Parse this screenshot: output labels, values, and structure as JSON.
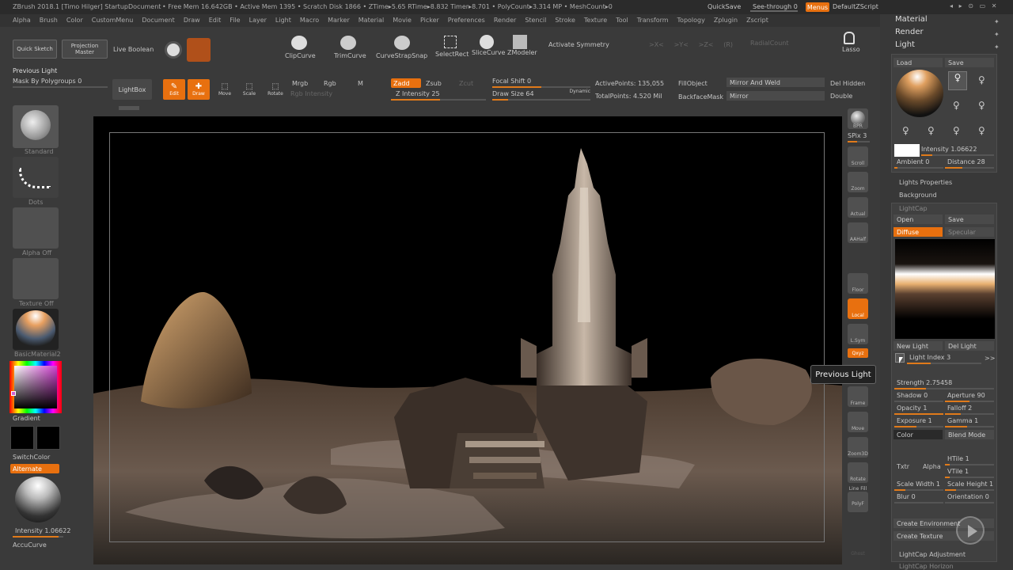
{
  "titlebar": {
    "title": "ZBrush 2018.1 [Timo Hilger]   StartupDocument",
    "stats": "• Free Mem 16.642GB • Active Mem 1395 • Scratch Disk 1866 • ZTime▸5.65 RTime▸8.832 Timer▸8.701 • PolyCount▸3.314 MP • MeshCount▸0",
    "quicksave": "QuickSave",
    "seethrough": "See-through  0",
    "menus": "Menus",
    "defaultzscript": "DefaultZScript"
  },
  "menubar": [
    "Alpha",
    "Brush",
    "Color",
    "CustomMenu",
    "Document",
    "Draw",
    "Edit",
    "File",
    "Layer",
    "Light",
    "Macro",
    "Marker",
    "Material",
    "Movie",
    "Picker",
    "Preferences",
    "Render",
    "Stencil",
    "Stroke",
    "Texture",
    "Tool",
    "Transform",
    "Topology",
    "Zplugin",
    "Zscript"
  ],
  "shelf1": {
    "quicksketch": "Quick Sketch",
    "projectionmaster": "Projection Master",
    "liveboolean": "Live Boolean",
    "clipcurve": "ClipCurve",
    "trimcurve": "TrimCurve",
    "curvestrapsnap": "CurveStrapSnap",
    "selectrect": "SelectRect",
    "slicecurve": "SliceCurve",
    "zmodeler": "ZModeler",
    "activatesymmetry": "Activate Symmetry",
    "lasso": "Lasso",
    "radialcount": "RadialCount"
  },
  "shelf2": {
    "previouslight": "Previous Light",
    "maskbypolygroups": "Mask By Polygroups 0",
    "lightbox": "LightBox",
    "edit": "Edit",
    "draw": "Draw",
    "move": "Move",
    "scale": "Scale",
    "rotate": "Rotate",
    "mrgb": "Mrgb",
    "rgb": "Rgb",
    "m": "M",
    "rgbintensity": "Rgb Intensity",
    "zadd": "Zadd",
    "zsub": "Zsub",
    "zcut": "Zcut",
    "zintensity": "Z Intensity 25",
    "focalshift": "Focal Shift 0",
    "drawsize": "Draw Size 64",
    "dynamic": "Dynamic",
    "activepoints": "ActivePoints: 135,055",
    "totalpoints": "TotalPoints: 4.520 Mil",
    "fillobject": "FillObject",
    "backfacemask": "BackfaceMask",
    "mirrorandweld": "Mirror And Weld",
    "mirror": "Mirror",
    "delhidden": "Del Hidden",
    "double": "Double"
  },
  "leftpanel": {
    "standard": "Standard",
    "dots": "Dots",
    "alphaoff": "Alpha Off",
    "textureoff": "Texture Off",
    "basicmaterial": "BasicMaterial2",
    "gradient": "Gradient",
    "switchcolor": "SwitchColor",
    "alternate": "Alternate",
    "intensity": "Intensity 1.06622",
    "accucurve": "AccuCurve"
  },
  "rightshelf": {
    "bpr": "BPR",
    "spix": "SPix 3",
    "scroll": "Scroll",
    "zoom": "Zoom",
    "actual": "Actual",
    "aahalf": "AAHalf",
    "floor": "Floor",
    "local": "Local",
    "lsym": "L.Sym",
    "xyz": "Qxyz",
    "frame": "Frame",
    "move": "Move",
    "zoom3d": "Zoom3D",
    "rotate": "Rotate",
    "linefill": "Line Fill",
    "polyf": "PolyF",
    "ghost": "Ghost"
  },
  "tooltip": "Previous Light",
  "palette": {
    "material": "Material",
    "render": "Render",
    "light": "Light",
    "load": "Load",
    "save": "Save",
    "intensity": "Intensity 1.06622",
    "ambient": "Ambient 0",
    "distance": "Distance 28",
    "lightsproperties": "Lights Properties",
    "background": "Background",
    "lightcap": "LightCap",
    "open": "Open",
    "save2": "Save",
    "diffuse": "Diffuse",
    "specular": "Specular",
    "newlight": "New Light",
    "dellight": "Del Light",
    "lightindex": "Light Index 3",
    "strength": "Strength 2.75458",
    "shadow": "Shadow 0",
    "aperture": "Aperture 90",
    "opacity": "Opacity 1",
    "falloff": "Falloff 2",
    "exposure": "Exposure 1",
    "gamma": "Gamma 1",
    "color": "Color",
    "blendmode": "Blend Mode",
    "txtr": "Txtr",
    "alpha": "Alpha",
    "htile": "HTile 1",
    "vtile": "VTile 1",
    "scalewidth": "Scale Width 1",
    "scaleheight": "Scale Height 1",
    "blur": "Blur 0",
    "orientation": "Orientation 0",
    "createenvironment": "Create Environment",
    "createtexture": "Create Texture",
    "lightcapadjustment": "LightCap Adjustment",
    "lightcaphorizon": "LightCap Horizon"
  },
  "colors": {
    "accent": "#e8700f",
    "background": "#3a3a3a",
    "canvas": "#000000"
  }
}
